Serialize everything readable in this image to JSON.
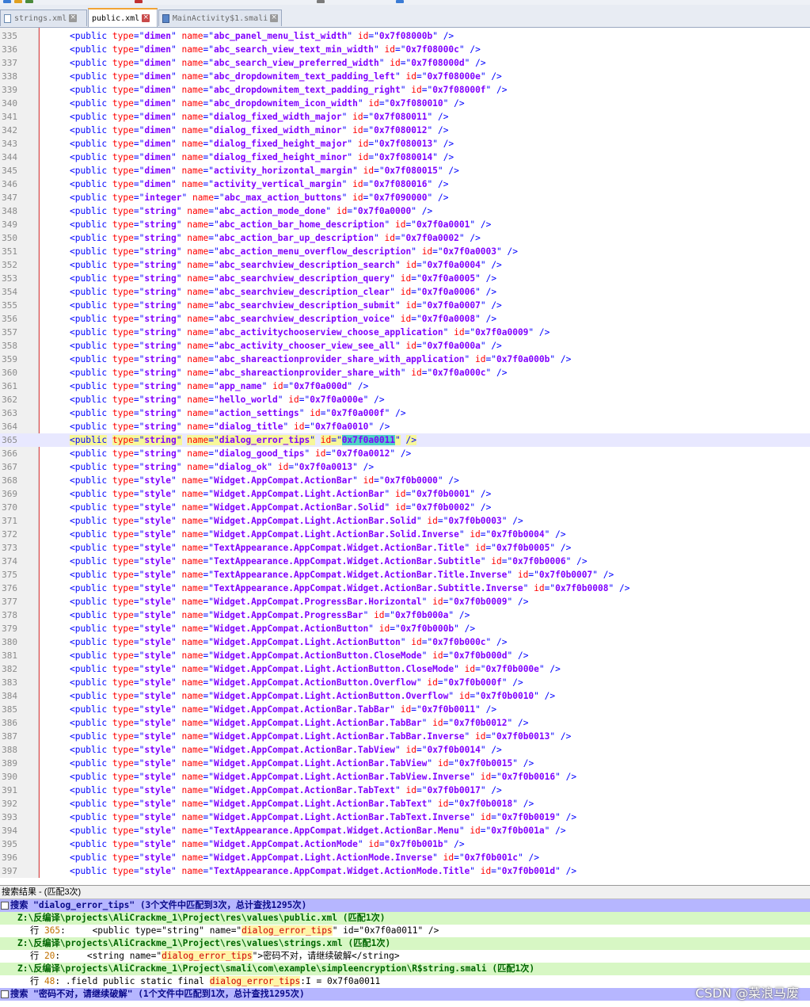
{
  "tabs": [
    {
      "label": "strings.xml",
      "active": false
    },
    {
      "label": "public.xml",
      "active": true
    },
    {
      "label": "MainActivity$1.smali",
      "active": false
    }
  ],
  "code_lines": [
    {
      "n": "335",
      "type": "dimen",
      "name": "abc_panel_menu_list_width",
      "id": "0x7f08000b"
    },
    {
      "n": "336",
      "type": "dimen",
      "name": "abc_search_view_text_min_width",
      "id": "0x7f08000c"
    },
    {
      "n": "337",
      "type": "dimen",
      "name": "abc_search_view_preferred_width",
      "id": "0x7f08000d"
    },
    {
      "n": "338",
      "type": "dimen",
      "name": "abc_dropdownitem_text_padding_left",
      "id": "0x7f08000e"
    },
    {
      "n": "339",
      "type": "dimen",
      "name": "abc_dropdownitem_text_padding_right",
      "id": "0x7f08000f"
    },
    {
      "n": "340",
      "type": "dimen",
      "name": "abc_dropdownitem_icon_width",
      "id": "0x7f080010"
    },
    {
      "n": "341",
      "type": "dimen",
      "name": "dialog_fixed_width_major",
      "id": "0x7f080011"
    },
    {
      "n": "342",
      "type": "dimen",
      "name": "dialog_fixed_width_minor",
      "id": "0x7f080012"
    },
    {
      "n": "343",
      "type": "dimen",
      "name": "dialog_fixed_height_major",
      "id": "0x7f080013"
    },
    {
      "n": "344",
      "type": "dimen",
      "name": "dialog_fixed_height_minor",
      "id": "0x7f080014"
    },
    {
      "n": "345",
      "type": "dimen",
      "name": "activity_horizontal_margin",
      "id": "0x7f080015"
    },
    {
      "n": "346",
      "type": "dimen",
      "name": "activity_vertical_margin",
      "id": "0x7f080016"
    },
    {
      "n": "347",
      "type": "integer",
      "name": "abc_max_action_buttons",
      "id": "0x7f090000"
    },
    {
      "n": "348",
      "type": "string",
      "name": "abc_action_mode_done",
      "id": "0x7f0a0000"
    },
    {
      "n": "349",
      "type": "string",
      "name": "abc_action_bar_home_description",
      "id": "0x7f0a0001"
    },
    {
      "n": "350",
      "type": "string",
      "name": "abc_action_bar_up_description",
      "id": "0x7f0a0002"
    },
    {
      "n": "351",
      "type": "string",
      "name": "abc_action_menu_overflow_description",
      "id": "0x7f0a0003"
    },
    {
      "n": "352",
      "type": "string",
      "name": "abc_searchview_description_search",
      "id": "0x7f0a0004"
    },
    {
      "n": "353",
      "type": "string",
      "name": "abc_searchview_description_query",
      "id": "0x7f0a0005"
    },
    {
      "n": "354",
      "type": "string",
      "name": "abc_searchview_description_clear",
      "id": "0x7f0a0006"
    },
    {
      "n": "355",
      "type": "string",
      "name": "abc_searchview_description_submit",
      "id": "0x7f0a0007"
    },
    {
      "n": "356",
      "type": "string",
      "name": "abc_searchview_description_voice",
      "id": "0x7f0a0008"
    },
    {
      "n": "357",
      "type": "string",
      "name": "abc_activitychooserview_choose_application",
      "id": "0x7f0a0009"
    },
    {
      "n": "358",
      "type": "string",
      "name": "abc_activity_chooser_view_see_all",
      "id": "0x7f0a000a"
    },
    {
      "n": "359",
      "type": "string",
      "name": "abc_shareactionprovider_share_with_application",
      "id": "0x7f0a000b"
    },
    {
      "n": "360",
      "type": "string",
      "name": "abc_shareactionprovider_share_with",
      "id": "0x7f0a000c"
    },
    {
      "n": "361",
      "type": "string",
      "name": "app_name",
      "id": "0x7f0a000d"
    },
    {
      "n": "362",
      "type": "string",
      "name": "hello_world",
      "id": "0x7f0a000e"
    },
    {
      "n": "363",
      "type": "string",
      "name": "action_settings",
      "id": "0x7f0a000f"
    },
    {
      "n": "364",
      "type": "string",
      "name": "dialog_title",
      "id": "0x7f0a0010"
    },
    {
      "n": "365",
      "type": "string",
      "name": "dialog_error_tips",
      "id": "0x7f0a0011",
      "current": true
    },
    {
      "n": "366",
      "type": "string",
      "name": "dialog_good_tips",
      "id": "0x7f0a0012"
    },
    {
      "n": "367",
      "type": "string",
      "name": "dialog_ok",
      "id": "0x7f0a0013"
    },
    {
      "n": "368",
      "type": "style",
      "name": "Widget.AppCompat.ActionBar",
      "id": "0x7f0b0000"
    },
    {
      "n": "369",
      "type": "style",
      "name": "Widget.AppCompat.Light.ActionBar",
      "id": "0x7f0b0001"
    },
    {
      "n": "370",
      "type": "style",
      "name": "Widget.AppCompat.ActionBar.Solid",
      "id": "0x7f0b0002"
    },
    {
      "n": "371",
      "type": "style",
      "name": "Widget.AppCompat.Light.ActionBar.Solid",
      "id": "0x7f0b0003"
    },
    {
      "n": "372",
      "type": "style",
      "name": "Widget.AppCompat.Light.ActionBar.Solid.Inverse",
      "id": "0x7f0b0004"
    },
    {
      "n": "373",
      "type": "style",
      "name": "TextAppearance.AppCompat.Widget.ActionBar.Title",
      "id": "0x7f0b0005"
    },
    {
      "n": "374",
      "type": "style",
      "name": "TextAppearance.AppCompat.Widget.ActionBar.Subtitle",
      "id": "0x7f0b0006"
    },
    {
      "n": "375",
      "type": "style",
      "name": "TextAppearance.AppCompat.Widget.ActionBar.Title.Inverse",
      "id": "0x7f0b0007"
    },
    {
      "n": "376",
      "type": "style",
      "name": "TextAppearance.AppCompat.Widget.ActionBar.Subtitle.Inverse",
      "id": "0x7f0b0008"
    },
    {
      "n": "377",
      "type": "style",
      "name": "Widget.AppCompat.ProgressBar.Horizontal",
      "id": "0x7f0b0009"
    },
    {
      "n": "378",
      "type": "style",
      "name": "Widget.AppCompat.ProgressBar",
      "id": "0x7f0b000a"
    },
    {
      "n": "379",
      "type": "style",
      "name": "Widget.AppCompat.ActionButton",
      "id": "0x7f0b000b"
    },
    {
      "n": "380",
      "type": "style",
      "name": "Widget.AppCompat.Light.ActionButton",
      "id": "0x7f0b000c"
    },
    {
      "n": "381",
      "type": "style",
      "name": "Widget.AppCompat.ActionButton.CloseMode",
      "id": "0x7f0b000d"
    },
    {
      "n": "382",
      "type": "style",
      "name": "Widget.AppCompat.Light.ActionButton.CloseMode",
      "id": "0x7f0b000e"
    },
    {
      "n": "383",
      "type": "style",
      "name": "Widget.AppCompat.ActionButton.Overflow",
      "id": "0x7f0b000f"
    },
    {
      "n": "384",
      "type": "style",
      "name": "Widget.AppCompat.Light.ActionButton.Overflow",
      "id": "0x7f0b0010"
    },
    {
      "n": "385",
      "type": "style",
      "name": "Widget.AppCompat.ActionBar.TabBar",
      "id": "0x7f0b0011"
    },
    {
      "n": "386",
      "type": "style",
      "name": "Widget.AppCompat.Light.ActionBar.TabBar",
      "id": "0x7f0b0012"
    },
    {
      "n": "387",
      "type": "style",
      "name": "Widget.AppCompat.Light.ActionBar.TabBar.Inverse",
      "id": "0x7f0b0013"
    },
    {
      "n": "388",
      "type": "style",
      "name": "Widget.AppCompat.ActionBar.TabView",
      "id": "0x7f0b0014"
    },
    {
      "n": "389",
      "type": "style",
      "name": "Widget.AppCompat.Light.ActionBar.TabView",
      "id": "0x7f0b0015"
    },
    {
      "n": "390",
      "type": "style",
      "name": "Widget.AppCompat.Light.ActionBar.TabView.Inverse",
      "id": "0x7f0b0016"
    },
    {
      "n": "391",
      "type": "style",
      "name": "Widget.AppCompat.ActionBar.TabText",
      "id": "0x7f0b0017"
    },
    {
      "n": "392",
      "type": "style",
      "name": "Widget.AppCompat.Light.ActionBar.TabText",
      "id": "0x7f0b0018"
    },
    {
      "n": "393",
      "type": "style",
      "name": "Widget.AppCompat.Light.ActionBar.TabText.Inverse",
      "id": "0x7f0b0019"
    },
    {
      "n": "394",
      "type": "style",
      "name": "TextAppearance.AppCompat.Widget.ActionBar.Menu",
      "id": "0x7f0b001a"
    },
    {
      "n": "395",
      "type": "style",
      "name": "Widget.AppCompat.ActionMode",
      "id": "0x7f0b001b"
    },
    {
      "n": "396",
      "type": "style",
      "name": "Widget.AppCompat.Light.ActionMode.Inverse",
      "id": "0x7f0b001c"
    },
    {
      "n": "397",
      "type": "style",
      "name": "TextAppearance.AppCompat.Widget.ActionMode.Title",
      "id": "0x7f0b001d"
    }
  ],
  "results": {
    "title": "搜索结果 - (匹配3次)",
    "search1": "搜索 \"dialog_error_tips\" (3个文件中匹配到3次，总计查找1295次)",
    "file1": "Z:\\反编译\\projects\\AliCrackme_1\\Project\\res\\values\\public.xml (匹配1次)",
    "hit1_label": "行 ",
    "hit1_num": "365",
    "hit1_pre": ":     <public type=\"string\" name=\"",
    "hit1_match": "dialog_error_tips",
    "hit1_post": "\" id=\"0x7f0a0011\" />",
    "file2": "Z:\\反编译\\projects\\AliCrackme_1\\Project\\res\\values\\strings.xml (匹配1次)",
    "hit2_label": "行 ",
    "hit2_num": "20",
    "hit2_pre": ":     <string name=\"",
    "hit2_match": "dialog_error_tips",
    "hit2_post": "\">密码不对，请继续破解</string>",
    "file3": "Z:\\反编译\\projects\\AliCrackme_1\\Project\\smali\\com\\example\\simpleencryption\\R$string.smali (匹配1次)",
    "hit3_label": "行 ",
    "hit3_num": "48",
    "hit3_pre": ": .field public static final ",
    "hit3_match": "dialog_error_tips",
    "hit3_post": ":I = 0x7f0a0011",
    "search2": "搜索 \"密码不对，请继续破解\" (1个文件中匹配到1次，总计查找1295次)"
  },
  "watermark": "CSDN @菜浪马废"
}
